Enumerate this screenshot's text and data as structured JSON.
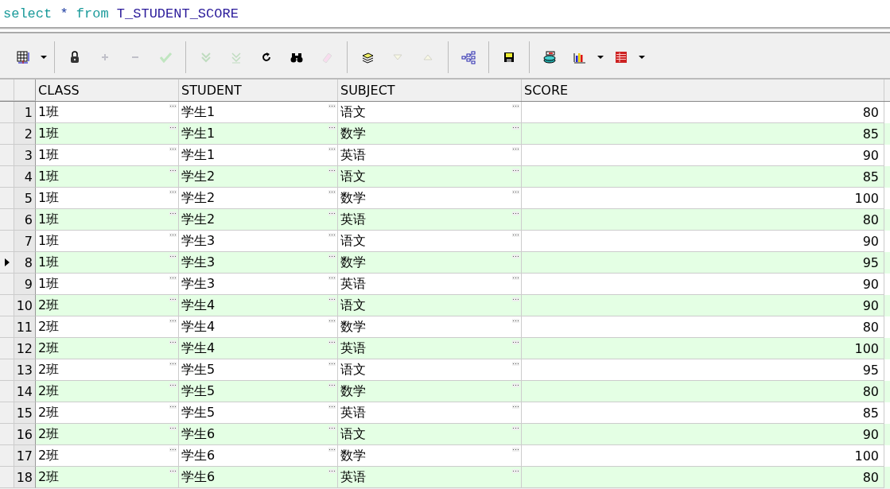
{
  "editor": {
    "sql": [
      {
        "kind": "keyword",
        "text": "select"
      },
      {
        "kind": "op",
        "text": "*"
      },
      {
        "kind": "keyword",
        "text": "from"
      },
      {
        "kind": "ident",
        "text": "T_STUDENT_SCORE"
      }
    ]
  },
  "toolbar": {
    "groups": [
      [
        {
          "kind": "grid",
          "disabled": false,
          "dropdown": true
        }
      ],
      [
        {
          "kind": "lock",
          "disabled": false,
          "dropdown": false
        },
        {
          "kind": "plus",
          "disabled": true,
          "dropdown": false
        },
        {
          "kind": "minus",
          "disabled": true,
          "dropdown": false
        },
        {
          "kind": "check",
          "disabled": true,
          "dropdown": false
        }
      ],
      [
        {
          "kind": "down2",
          "disabled": true,
          "dropdown": false
        },
        {
          "kind": "down2b",
          "disabled": true,
          "dropdown": false
        },
        {
          "kind": "refresh",
          "disabled": false,
          "dropdown": false
        },
        {
          "kind": "find",
          "disabled": false,
          "dropdown": false
        },
        {
          "kind": "eraser",
          "disabled": true,
          "dropdown": false
        }
      ],
      [
        {
          "kind": "pages",
          "disabled": false,
          "dropdown": false
        },
        {
          "kind": "down",
          "disabled": true,
          "dropdown": false
        },
        {
          "kind": "up",
          "disabled": true,
          "dropdown": false
        }
      ],
      [
        {
          "kind": "tree",
          "disabled": false,
          "dropdown": false
        }
      ],
      [
        {
          "kind": "save",
          "disabled": false,
          "dropdown": false
        }
      ],
      [
        {
          "kind": "db",
          "disabled": false,
          "dropdown": false
        },
        {
          "kind": "chart",
          "disabled": false,
          "dropdown": true
        },
        {
          "kind": "table",
          "disabled": false,
          "dropdown": true
        }
      ]
    ]
  },
  "table": {
    "columns": [
      {
        "label": "CLASS",
        "kind": "text"
      },
      {
        "label": "STUDENT",
        "kind": "text"
      },
      {
        "label": "SUBJECT",
        "kind": "text"
      },
      {
        "label": "SCORE",
        "kind": "number"
      }
    ],
    "rows": [
      {
        "num": "1",
        "selected": false,
        "cells": [
          "1班",
          "学生1",
          "语文",
          "80"
        ]
      },
      {
        "num": "2",
        "selected": false,
        "cells": [
          "1班",
          "学生1",
          "数学",
          "85"
        ]
      },
      {
        "num": "3",
        "selected": false,
        "cells": [
          "1班",
          "学生1",
          "英语",
          "90"
        ]
      },
      {
        "num": "4",
        "selected": false,
        "cells": [
          "1班",
          "学生2",
          "语文",
          "85"
        ]
      },
      {
        "num": "5",
        "selected": false,
        "cells": [
          "1班",
          "学生2",
          "数学",
          "100"
        ]
      },
      {
        "num": "6",
        "selected": false,
        "cells": [
          "1班",
          "学生2",
          "英语",
          "80"
        ]
      },
      {
        "num": "7",
        "selected": false,
        "cells": [
          "1班",
          "学生3",
          "语文",
          "90"
        ]
      },
      {
        "num": "8",
        "selected": true,
        "cells": [
          "1班",
          "学生3",
          "数学",
          "95"
        ]
      },
      {
        "num": "9",
        "selected": false,
        "cells": [
          "1班",
          "学生3",
          "英语",
          "90"
        ]
      },
      {
        "num": "10",
        "selected": false,
        "cells": [
          "2班",
          "学生4",
          "语文",
          "90"
        ]
      },
      {
        "num": "11",
        "selected": false,
        "cells": [
          "2班",
          "学生4",
          "数学",
          "80"
        ]
      },
      {
        "num": "12",
        "selected": false,
        "cells": [
          "2班",
          "学生4",
          "英语",
          "100"
        ]
      },
      {
        "num": "13",
        "selected": false,
        "cells": [
          "2班",
          "学生5",
          "语文",
          "95"
        ]
      },
      {
        "num": "14",
        "selected": false,
        "cells": [
          "2班",
          "学生5",
          "数学",
          "80"
        ]
      },
      {
        "num": "15",
        "selected": false,
        "cells": [
          "2班",
          "学生5",
          "英语",
          "85"
        ]
      },
      {
        "num": "16",
        "selected": false,
        "cells": [
          "2班",
          "学生6",
          "语文",
          "90"
        ]
      },
      {
        "num": "17",
        "selected": false,
        "cells": [
          "2班",
          "学生6",
          "数学",
          "100"
        ]
      },
      {
        "num": "18",
        "selected": false,
        "cells": [
          "2班",
          "学生6",
          "英语",
          "80"
        ]
      }
    ]
  }
}
